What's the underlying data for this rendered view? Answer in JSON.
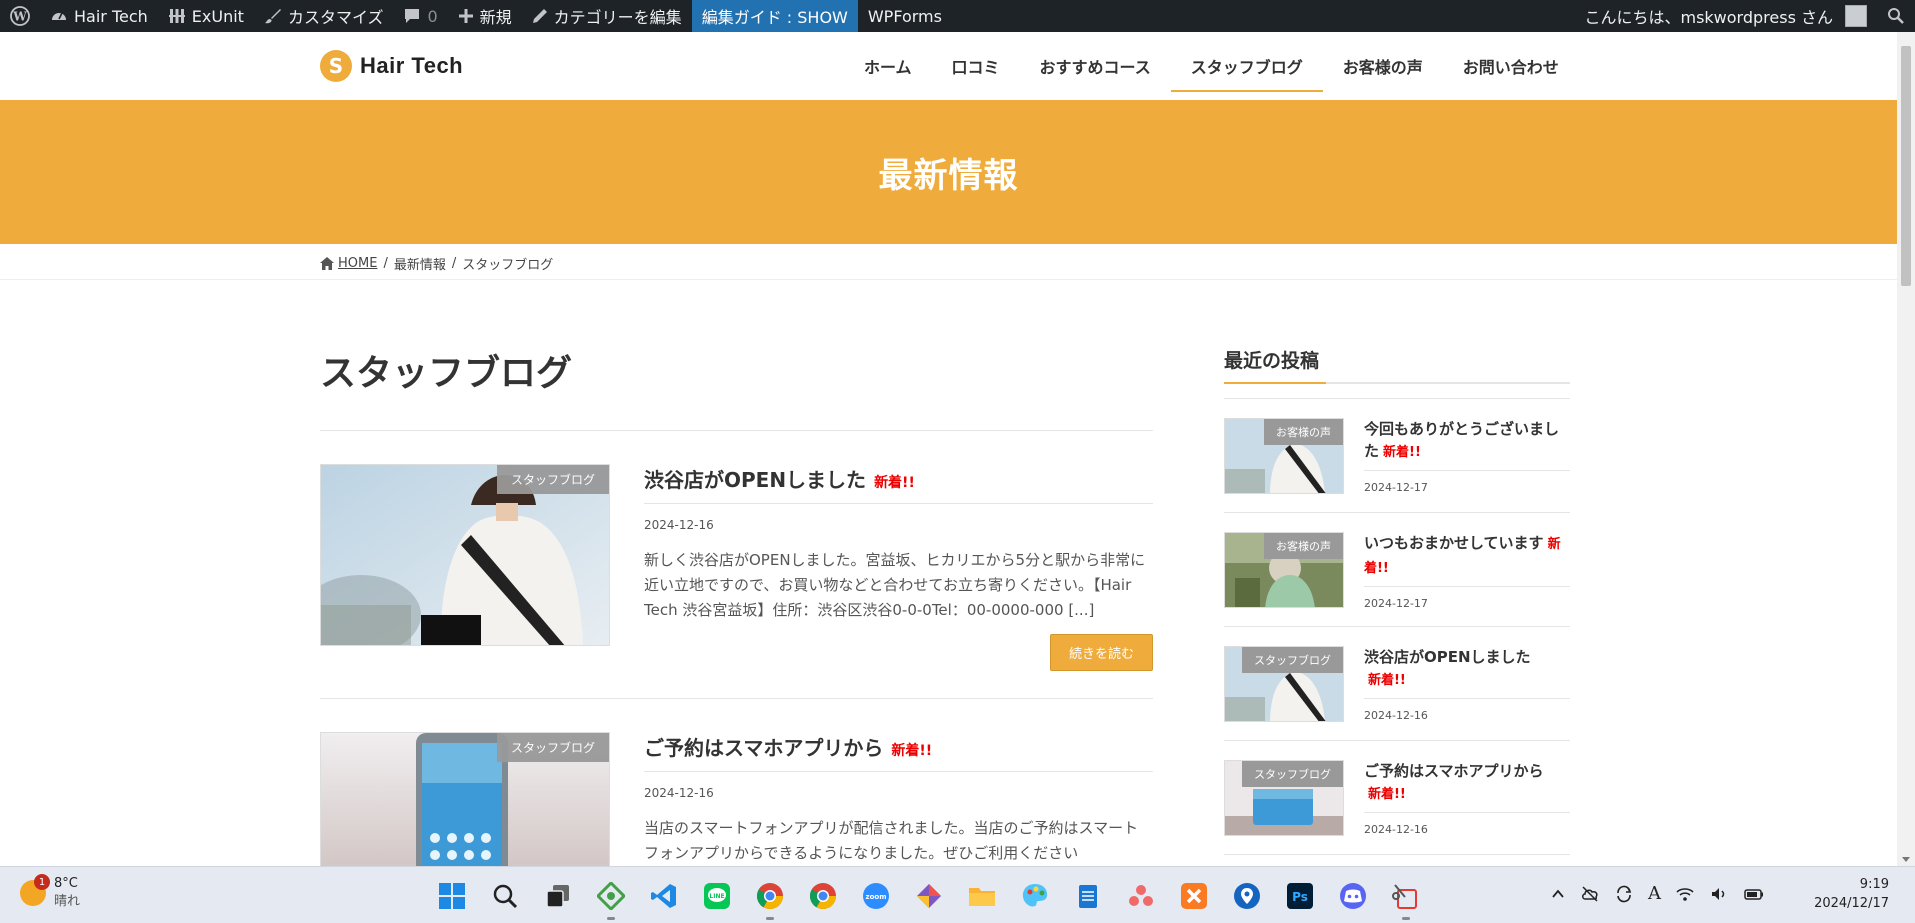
{
  "admin_bar": {
    "site_name": "Hair Tech",
    "exunit": "ExUnit",
    "customize": "カスタマイズ",
    "comments_count": "0",
    "new": "新規",
    "edit_category": "カテゴリーを編集",
    "guide": "編集ガイド : SHOW",
    "wpforms": "WPForms",
    "greeting": "こんにちは、mskwordpress さん"
  },
  "header": {
    "logo_text": "Hair Tech",
    "logo_mark": "S",
    "nav": [
      {
        "label": "ホーム"
      },
      {
        "label": "口コミ"
      },
      {
        "label": "おすすめコース"
      },
      {
        "label": "スタッフブログ",
        "active": true
      },
      {
        "label": "お客様の声"
      },
      {
        "label": "お問い合わせ"
      }
    ]
  },
  "hero": {
    "title": "最新情報"
  },
  "breadcrumb": {
    "home": "HOME",
    "sep": "/",
    "level1": "最新情報",
    "level2": "スタッフブログ"
  },
  "main": {
    "title": "スタッフブログ",
    "posts": [
      {
        "category": "スタッフブログ",
        "title": "渋谷店がOPENしました",
        "new_label": "新着!!",
        "date": "2024-12-16",
        "excerpt": "新しく渋谷店がOPENしました。宮益坂、ヒカリエから5分と駅から非常に近い立地ですので、お買い物などと合わせてお立ち寄りください。【Hair Tech 渋谷宮益坂】住所：渋谷区渋谷0-0-0Tel：00-0000-000 [...]",
        "read_more": "続きを読む"
      },
      {
        "category": "スタッフブログ",
        "title": "ご予約はスマホアプリから",
        "new_label": "新着!!",
        "date": "2024-12-16",
        "excerpt": "当店のスマートフォンアプリが配信されました。当店のご予約はスマートフォンアプリからできるようになりました。ぜひご利用ください"
      }
    ]
  },
  "sidebar": {
    "title": "最近の投稿",
    "items": [
      {
        "category": "お客様の声",
        "title": "今回もありがとうございました",
        "new_label": "新着!!",
        "date": "2024-12-17"
      },
      {
        "category": "お客様の声",
        "title": "いつもおまかせしています",
        "new_label": "新着!!",
        "date": "2024-12-17"
      },
      {
        "category": "スタッフブログ",
        "title": "渋谷店がOPENしました",
        "new_label": "新着!!",
        "date": "2024-12-16"
      },
      {
        "category": "スタッフブログ",
        "title": "ご予約はスマホアプリから",
        "new_label": "新着!!",
        "date": "2024-12-16"
      }
    ]
  },
  "taskbar": {
    "weather_badge": "1",
    "temperature": "8°C",
    "condition": "晴れ",
    "time": "9:19",
    "date": "2024/12/17",
    "ime": "A"
  },
  "colors": {
    "accent": "#efac3c",
    "admin_bar": "#1d2327",
    "guide": "#2271b1",
    "new": "#ee0000"
  }
}
